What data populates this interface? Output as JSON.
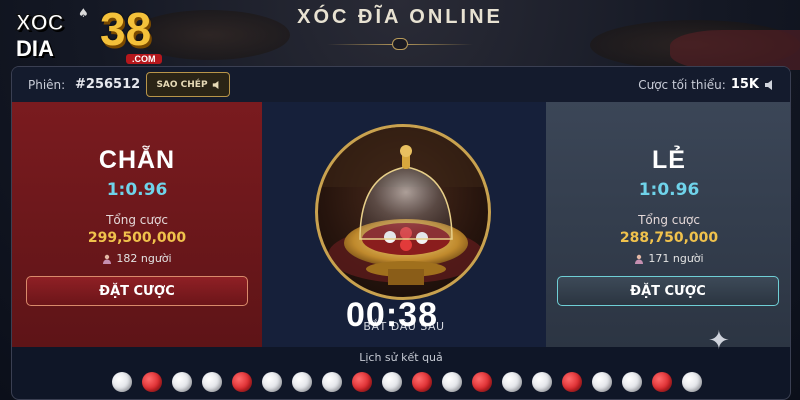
{
  "header": {
    "logo_text_line1": "XOC",
    "logo_text_line2": "DIA",
    "logo_number": "38",
    "logo_suffix": ".COM",
    "title": "XÓC ĐĨA ONLINE"
  },
  "session": {
    "label": "Phiên:",
    "id": "#256512",
    "copy_label": "SAO CHÉP",
    "min_bet_label": "Cược tối thiểu:",
    "min_bet_value": "15K"
  },
  "even": {
    "name": "CHẴN",
    "ratio": "1:0.96",
    "total_label": "Tổng cược",
    "total": "299,500,000",
    "players": "182 người",
    "bet_label": "ĐẶT CƯỢC"
  },
  "odd": {
    "name": "LẺ",
    "ratio": "1:0.96",
    "total_label": "Tổng cược",
    "total": "288,750,000",
    "players": "171 người",
    "bet_label": "ĐẶT CƯỢC"
  },
  "countdown": {
    "label": "BẮT ĐẦU SAU",
    "time": "00:38"
  },
  "history": {
    "label": "Lịch sử kết quả",
    "results": [
      "white",
      "red",
      "white",
      "white",
      "red",
      "white",
      "white",
      "white",
      "red",
      "white",
      "red",
      "white",
      "red",
      "white",
      "white",
      "red",
      "white",
      "white",
      "red",
      "white"
    ]
  },
  "colors": {
    "even_panel": "#7a1b1f",
    "odd_panel": "#3b4657",
    "ratio_text": "#6fd3ea",
    "total_text": "#f0c24c",
    "accent_gold": "#c9a24f"
  },
  "icons": {
    "copy": "speaker-icon",
    "min_bet": "speaker-icon",
    "players": "person-icon",
    "sparkle": "sparkle-icon"
  }
}
